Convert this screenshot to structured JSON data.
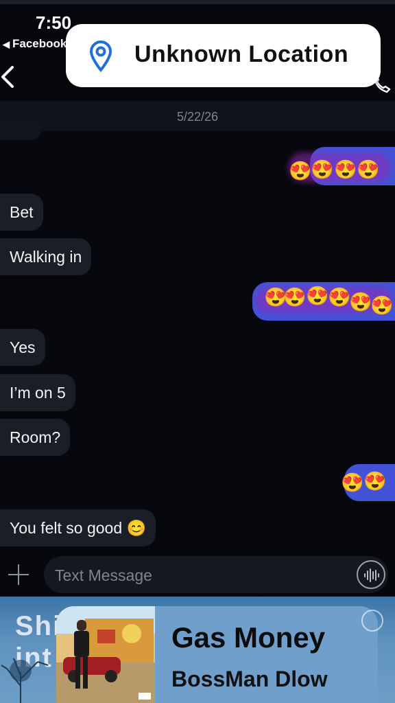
{
  "status": {
    "time": "7:50",
    "back_app": "Facebook"
  },
  "location": {
    "label": "Unknown Location"
  },
  "thread": {
    "date": "5/22/26"
  },
  "messages": {
    "m1": {
      "direction": "outgoing",
      "emoji": [
        "😍",
        "😍",
        "😍",
        "😍"
      ]
    },
    "m2": {
      "direction": "incoming",
      "text": "Bet"
    },
    "m3": {
      "direction": "incoming",
      "text": "Walking in"
    },
    "m4": {
      "direction": "outgoing",
      "emoji": [
        "😍",
        "😍",
        "😍",
        "😍",
        "😍",
        "😍"
      ]
    },
    "m5": {
      "direction": "incoming",
      "text": "Yes"
    },
    "m6": {
      "direction": "incoming",
      "text": "I’m on 5"
    },
    "m7": {
      "direction": "incoming",
      "text": "Room?"
    },
    "m8": {
      "direction": "outgoing",
      "emoji": [
        "😍",
        "😍"
      ]
    },
    "m9": {
      "direction": "incoming",
      "text": "You felt so good 😊"
    }
  },
  "composer": {
    "placeholder": "Text Message"
  },
  "now_playing": {
    "background_title": "Shi\nint",
    "song": "Gas Money",
    "artist": "BossMan Dlow"
  },
  "colors": {
    "background": "#06080d",
    "incoming_bubble": "#1a1f27",
    "outgoing_bubble": "#4353d7",
    "music_bar": "#6d9ec6"
  },
  "icons": [
    "chevron-left-icon",
    "location-pin-icon",
    "plus-icon",
    "voice-waveform-icon"
  ]
}
